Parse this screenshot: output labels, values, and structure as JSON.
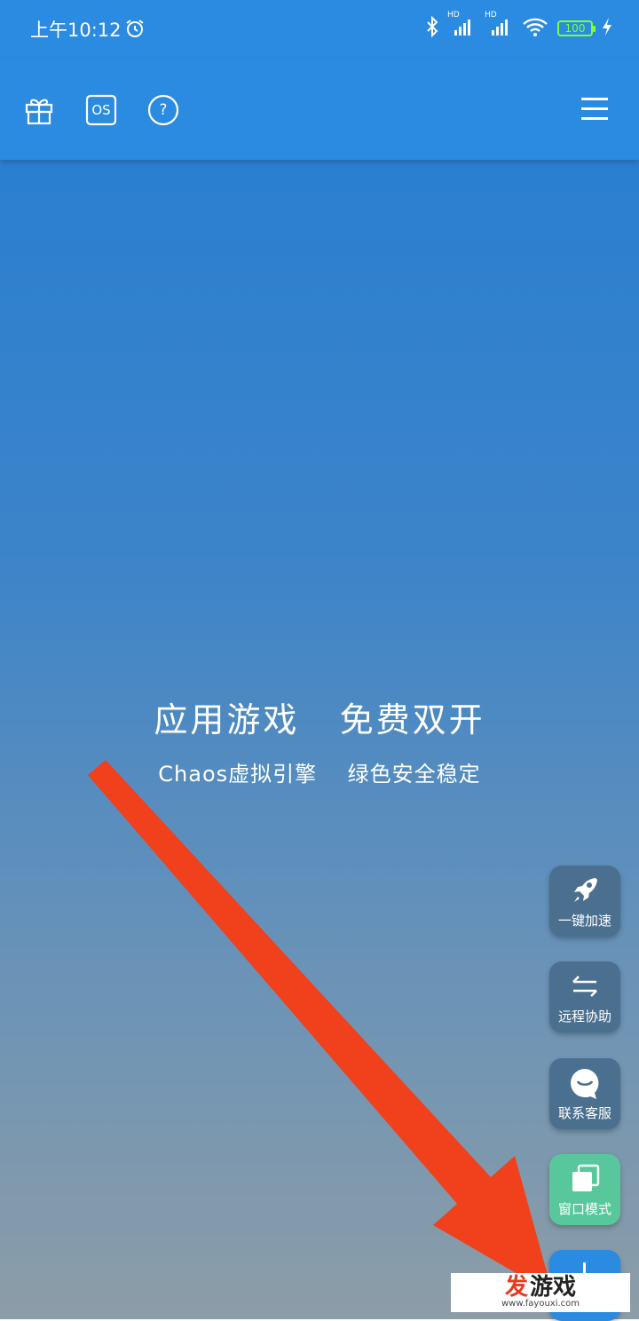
{
  "status_bar": {
    "time": "上午10:12",
    "battery": "100",
    "icons": [
      "alarm-icon",
      "bluetooth-icon",
      "signal-hd-icon",
      "signal-hd-icon",
      "wifi-icon",
      "battery-icon",
      "charging-icon"
    ],
    "hd_label": "HD"
  },
  "toolbar": {
    "icons": [
      "gift-icon",
      "os-icon",
      "help-icon",
      "menu-icon"
    ],
    "os_label": "OS",
    "help_label": "?"
  },
  "main": {
    "headline": "应用游戏   免费双开",
    "subline": "Chaos虚拟引擎    绿色安全稳定"
  },
  "side_buttons": {
    "speed": "一键加速",
    "remote": "远程协助",
    "service": "联系客服",
    "window": "窗口模式"
  },
  "watermark": {
    "brand_a": "发",
    "brand_b": "游戏",
    "url": "www.fayouxi.com"
  },
  "colors": {
    "primary": "#2a8be0",
    "side_button": "#4a6f8f",
    "window_button": "#58c79c",
    "arrow": "#f0401c"
  }
}
